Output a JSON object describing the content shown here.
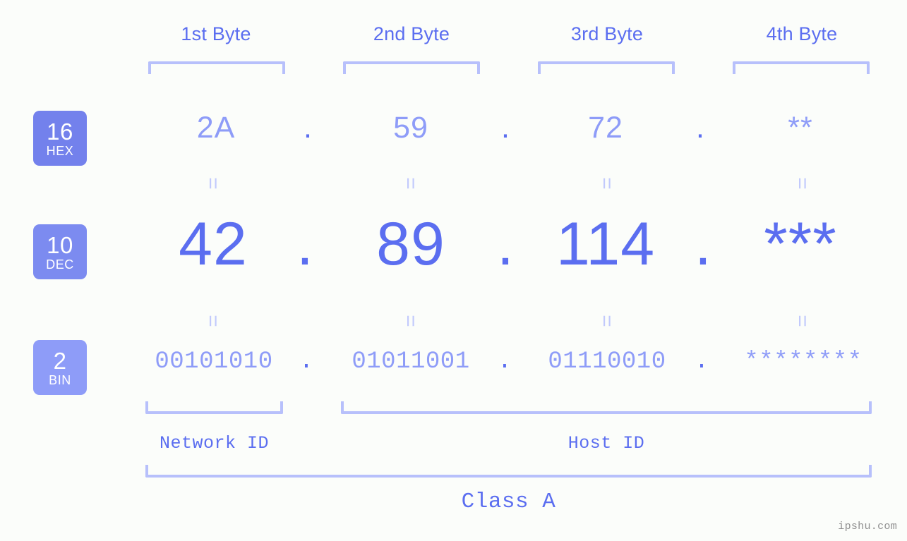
{
  "background_color": "#fbfdfa",
  "accent_colors": {
    "primary_blue": "#5b6ef0",
    "light_blue": "#8e9cf8",
    "bracket_blue": "#b7c0fb",
    "eq_blue": "#c2cafc",
    "badge_hex": "#7381ec",
    "badge_dec": "#7c8bf0",
    "badge_bin": "#8e9cf8",
    "watermark_gray": "#8f8f8f"
  },
  "byte_headers": [
    {
      "label": "1st Byte"
    },
    {
      "label": "2nd Byte"
    },
    {
      "label": "3rd Byte"
    },
    {
      "label": "4th Byte"
    }
  ],
  "bases": [
    {
      "number": "16",
      "name": "HEX"
    },
    {
      "number": "10",
      "name": "DEC"
    },
    {
      "number": "2",
      "name": "BIN"
    }
  ],
  "rows": {
    "hex": {
      "values": [
        "2A",
        "59",
        "72",
        "**"
      ],
      "separators": [
        ".",
        ".",
        "."
      ]
    },
    "dec": {
      "values": [
        "42",
        "89",
        "114",
        "***"
      ],
      "separators": [
        ".",
        ".",
        "."
      ]
    },
    "bin": {
      "values": [
        "00101010",
        "01011001",
        "01110010",
        "********"
      ],
      "separators": [
        ".",
        ".",
        "."
      ]
    }
  },
  "equality_marks": {
    "glyph": "=",
    "count_per_row": 4
  },
  "sections": {
    "network_id": "Network ID",
    "host_id": "Host ID",
    "class": "Class A"
  },
  "watermark": "ipshu.com"
}
